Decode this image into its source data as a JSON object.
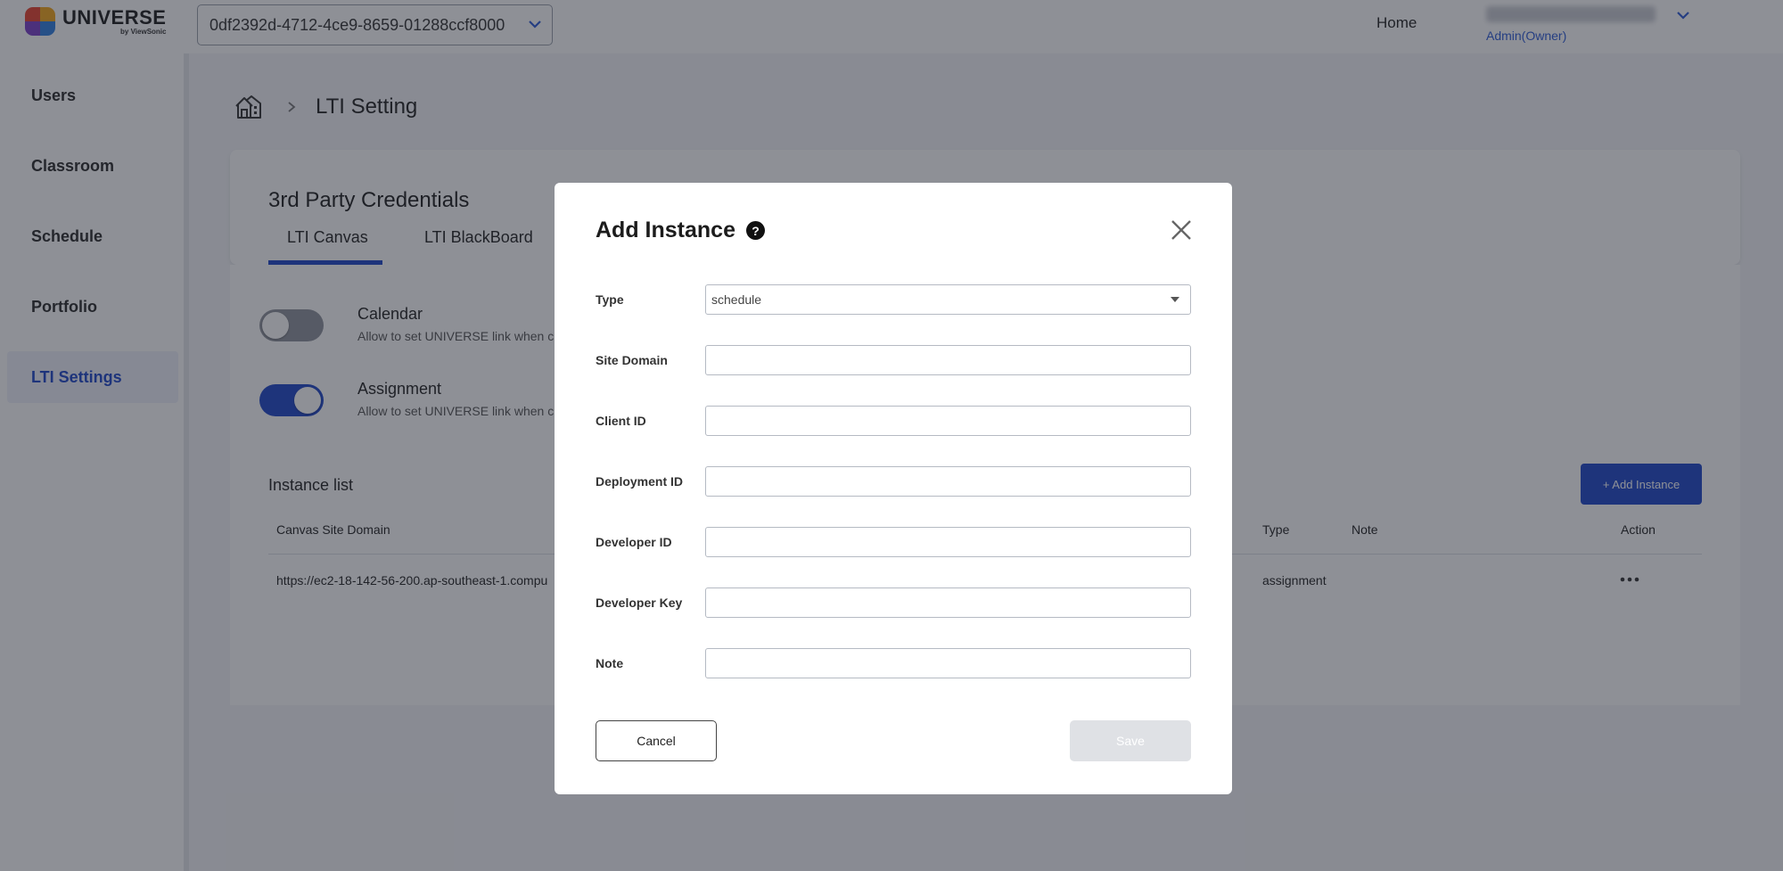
{
  "app": {
    "brand": "UNIVERSE",
    "brand_sub": "by ViewSonic",
    "org_id": "0df2392d-4712-4ce9-8659-01288ccf8000",
    "nav_home": "Home",
    "user_role": "Admin(Owner)"
  },
  "sidebar": {
    "items": [
      {
        "label": "Users"
      },
      {
        "label": "Classroom"
      },
      {
        "label": "Schedule"
      },
      {
        "label": "Portfolio"
      },
      {
        "label": "LTI Settings"
      }
    ]
  },
  "page": {
    "breadcrumb_title": "LTI Setting",
    "card_title": "3rd Party Credentials",
    "tabs": [
      {
        "label": "LTI Canvas"
      },
      {
        "label": "LTI BlackBoard"
      }
    ],
    "features": [
      {
        "title": "Calendar",
        "desc": "Allow to set UNIVERSE link when cr",
        "enabled": false
      },
      {
        "title": "Assignment",
        "desc": "Allow to set UNIVERSE link when cr",
        "enabled": true
      }
    ],
    "instance_list_title": "Instance list",
    "add_instance_label": "+ Add Instance",
    "table": {
      "headers": [
        "Canvas Site Domain",
        "Type",
        "Note",
        "Action"
      ],
      "rows": [
        {
          "domain": "https://ec2-18-142-56-200.ap-southeast-1.compu",
          "type": "assignment",
          "note": ""
        }
      ]
    }
  },
  "modal": {
    "title": "Add Instance",
    "help": "?",
    "fields": [
      {
        "label": "Type",
        "value": "schedule"
      },
      {
        "label": "Site Domain",
        "value": ""
      },
      {
        "label": "Client ID",
        "value": ""
      },
      {
        "label": "Deployment ID",
        "value": ""
      },
      {
        "label": "Developer ID",
        "value": ""
      },
      {
        "label": "Developer Key",
        "value": ""
      },
      {
        "label": "Note",
        "value": ""
      }
    ],
    "cancel_label": "Cancel",
    "save_label": "Save"
  },
  "colors": {
    "accent": "#1f47c9",
    "toggle_off": "#8f939c",
    "disabled_button": "#dfe1e5"
  }
}
